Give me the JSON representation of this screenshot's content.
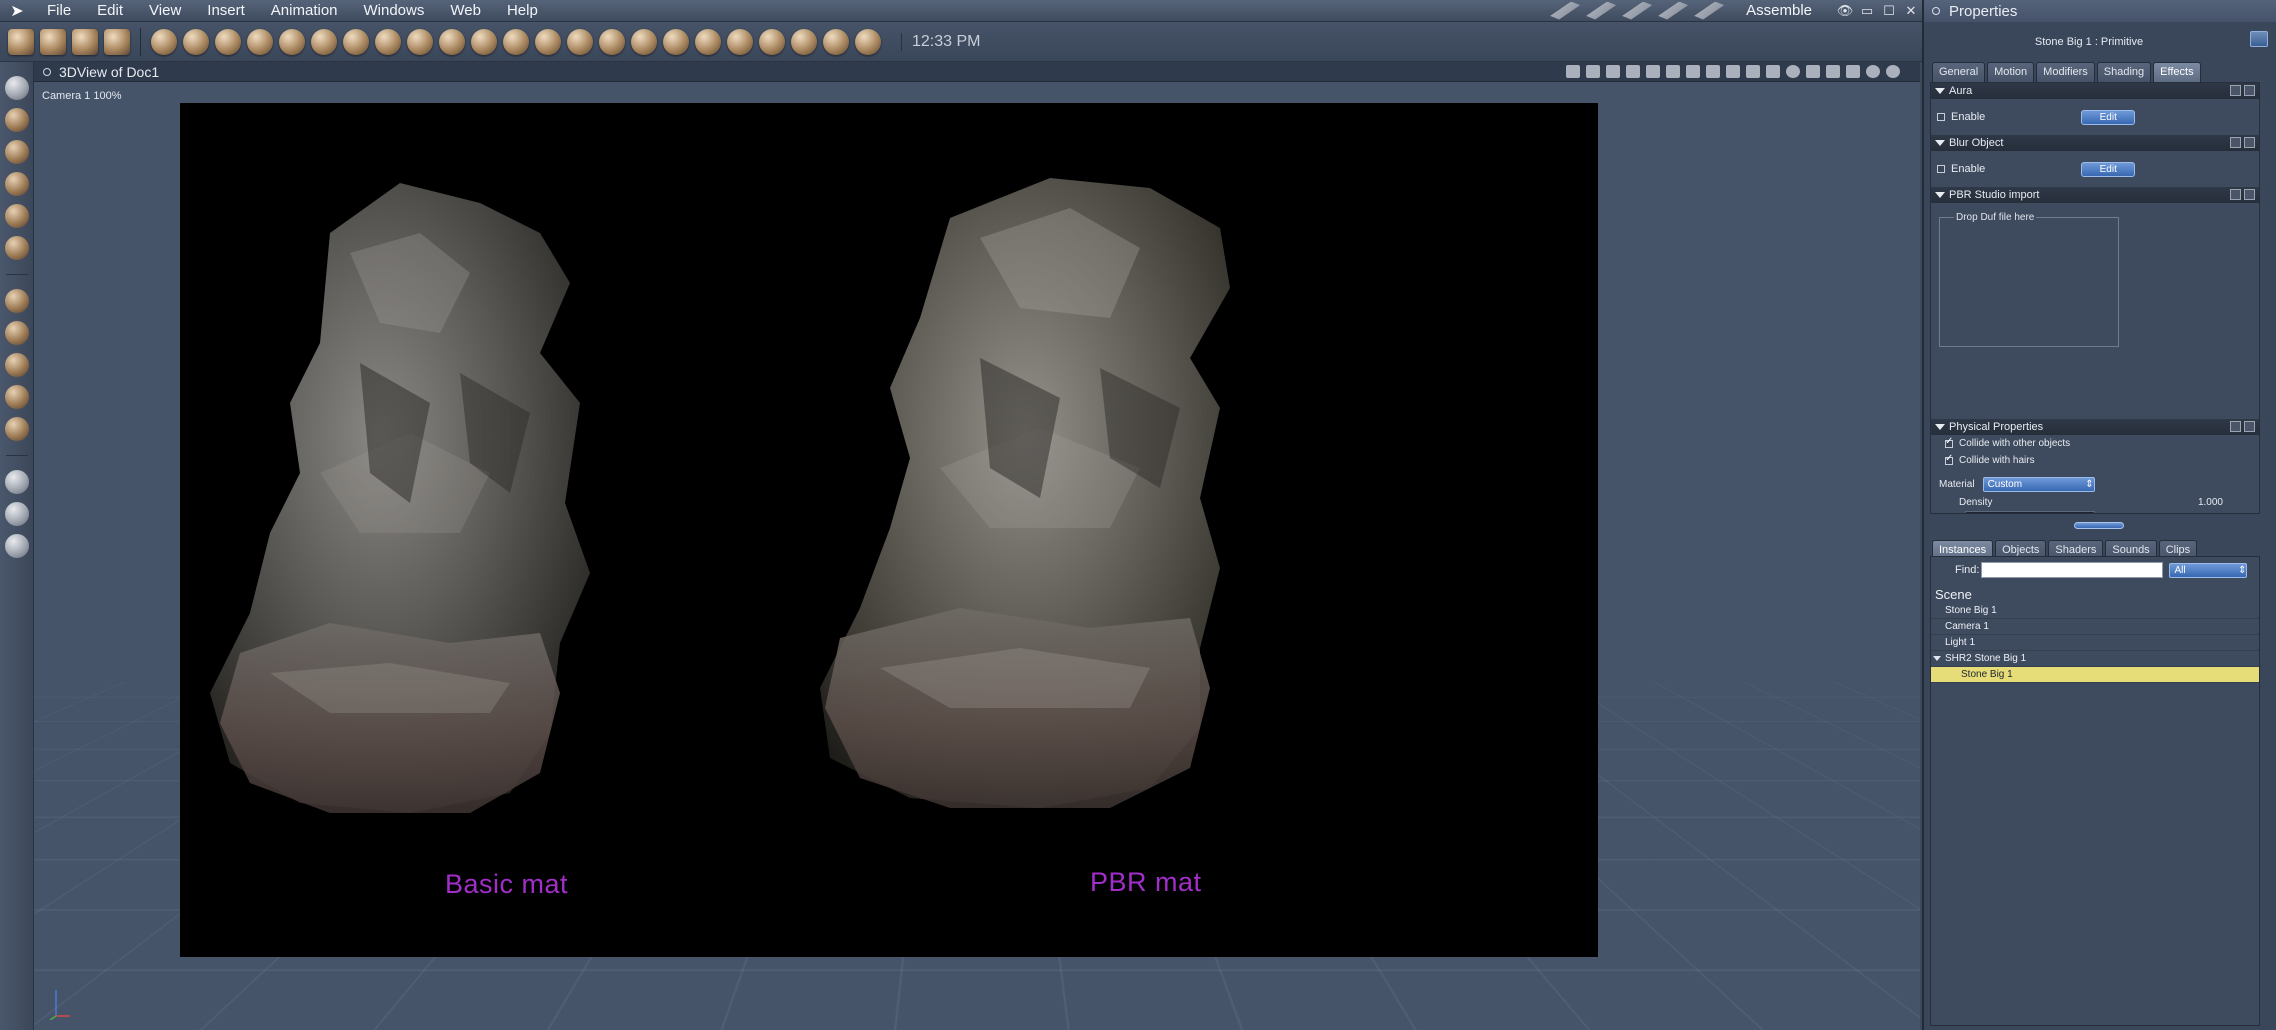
{
  "app": {
    "menu": [
      "File",
      "Edit",
      "View",
      "Insert",
      "Animation",
      "Windows",
      "Web",
      "Help"
    ],
    "room": "Assemble",
    "clock": "12:33 PM"
  },
  "view": {
    "title": "3DView of Doc1",
    "camera_label": "Camera 1 100%",
    "caption_left": "Basic mat",
    "caption_right": "PBR mat"
  },
  "properties": {
    "panel_title": "Properties",
    "object_title": "Stone Big 1 : Primitive",
    "tabs": [
      "General",
      "Motion",
      "Modifiers",
      "Shading",
      "Effects"
    ],
    "active_tab": "Effects",
    "aura": {
      "title": "Aura",
      "enable_label": "Enable",
      "edit_label": "Edit"
    },
    "blur": {
      "title": "Blur Object",
      "enable_label": "Enable",
      "edit_label": "Edit"
    },
    "pbr": {
      "title": "PBR Studio import",
      "drop_label": "Drop Duf file here"
    },
    "physical": {
      "title": "Physical Properties",
      "collide_objects": "Collide with other objects",
      "collide_hairs": "Collide with hairs",
      "material_label": "Material",
      "material_value": "Custom",
      "density_label": "Density",
      "density_value": "1.000"
    }
  },
  "scene": {
    "tabs": [
      "Instances",
      "Objects",
      "Shaders",
      "Sounds",
      "Clips"
    ],
    "active_tab": "Instances",
    "find_label": "Find:",
    "filter_value": "All",
    "title": "Scene",
    "items": [
      "Stone Big 1",
      "Camera 1",
      "Light 1"
    ],
    "group": "SHR2 Stone Big 1",
    "group_child": "Stone Big 1"
  },
  "colors": {
    "caption": "#a22ec9",
    "selection": "#e6dd78",
    "accent_button": "#3868b2"
  }
}
